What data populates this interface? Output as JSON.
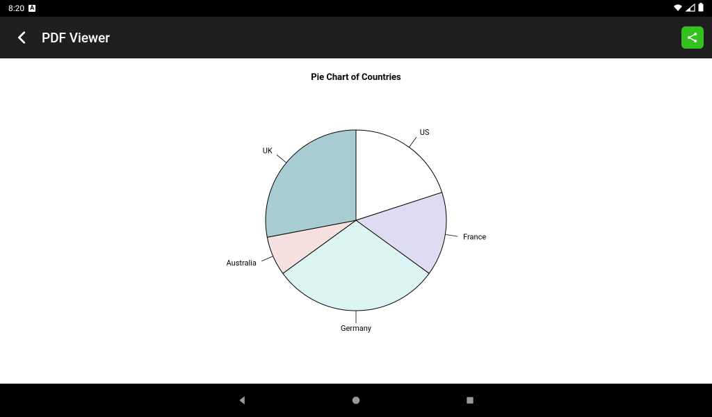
{
  "status": {
    "time": "8:20",
    "a_icon": "A"
  },
  "appbar": {
    "title": "PDF Viewer"
  },
  "chart_data": {
    "type": "pie",
    "title": "Pie Chart of Countries",
    "slices": [
      {
        "label": "US",
        "value": 20,
        "color": "#ffffff"
      },
      {
        "label": "France",
        "value": 15,
        "color": "#dedcf3"
      },
      {
        "label": "Germany",
        "value": 30,
        "color": "#dcf5f3"
      },
      {
        "label": "Australia",
        "value": 7,
        "color": "#f7e0e0"
      },
      {
        "label": "UK",
        "value": 28,
        "color": "#a7ccd1"
      }
    ]
  }
}
